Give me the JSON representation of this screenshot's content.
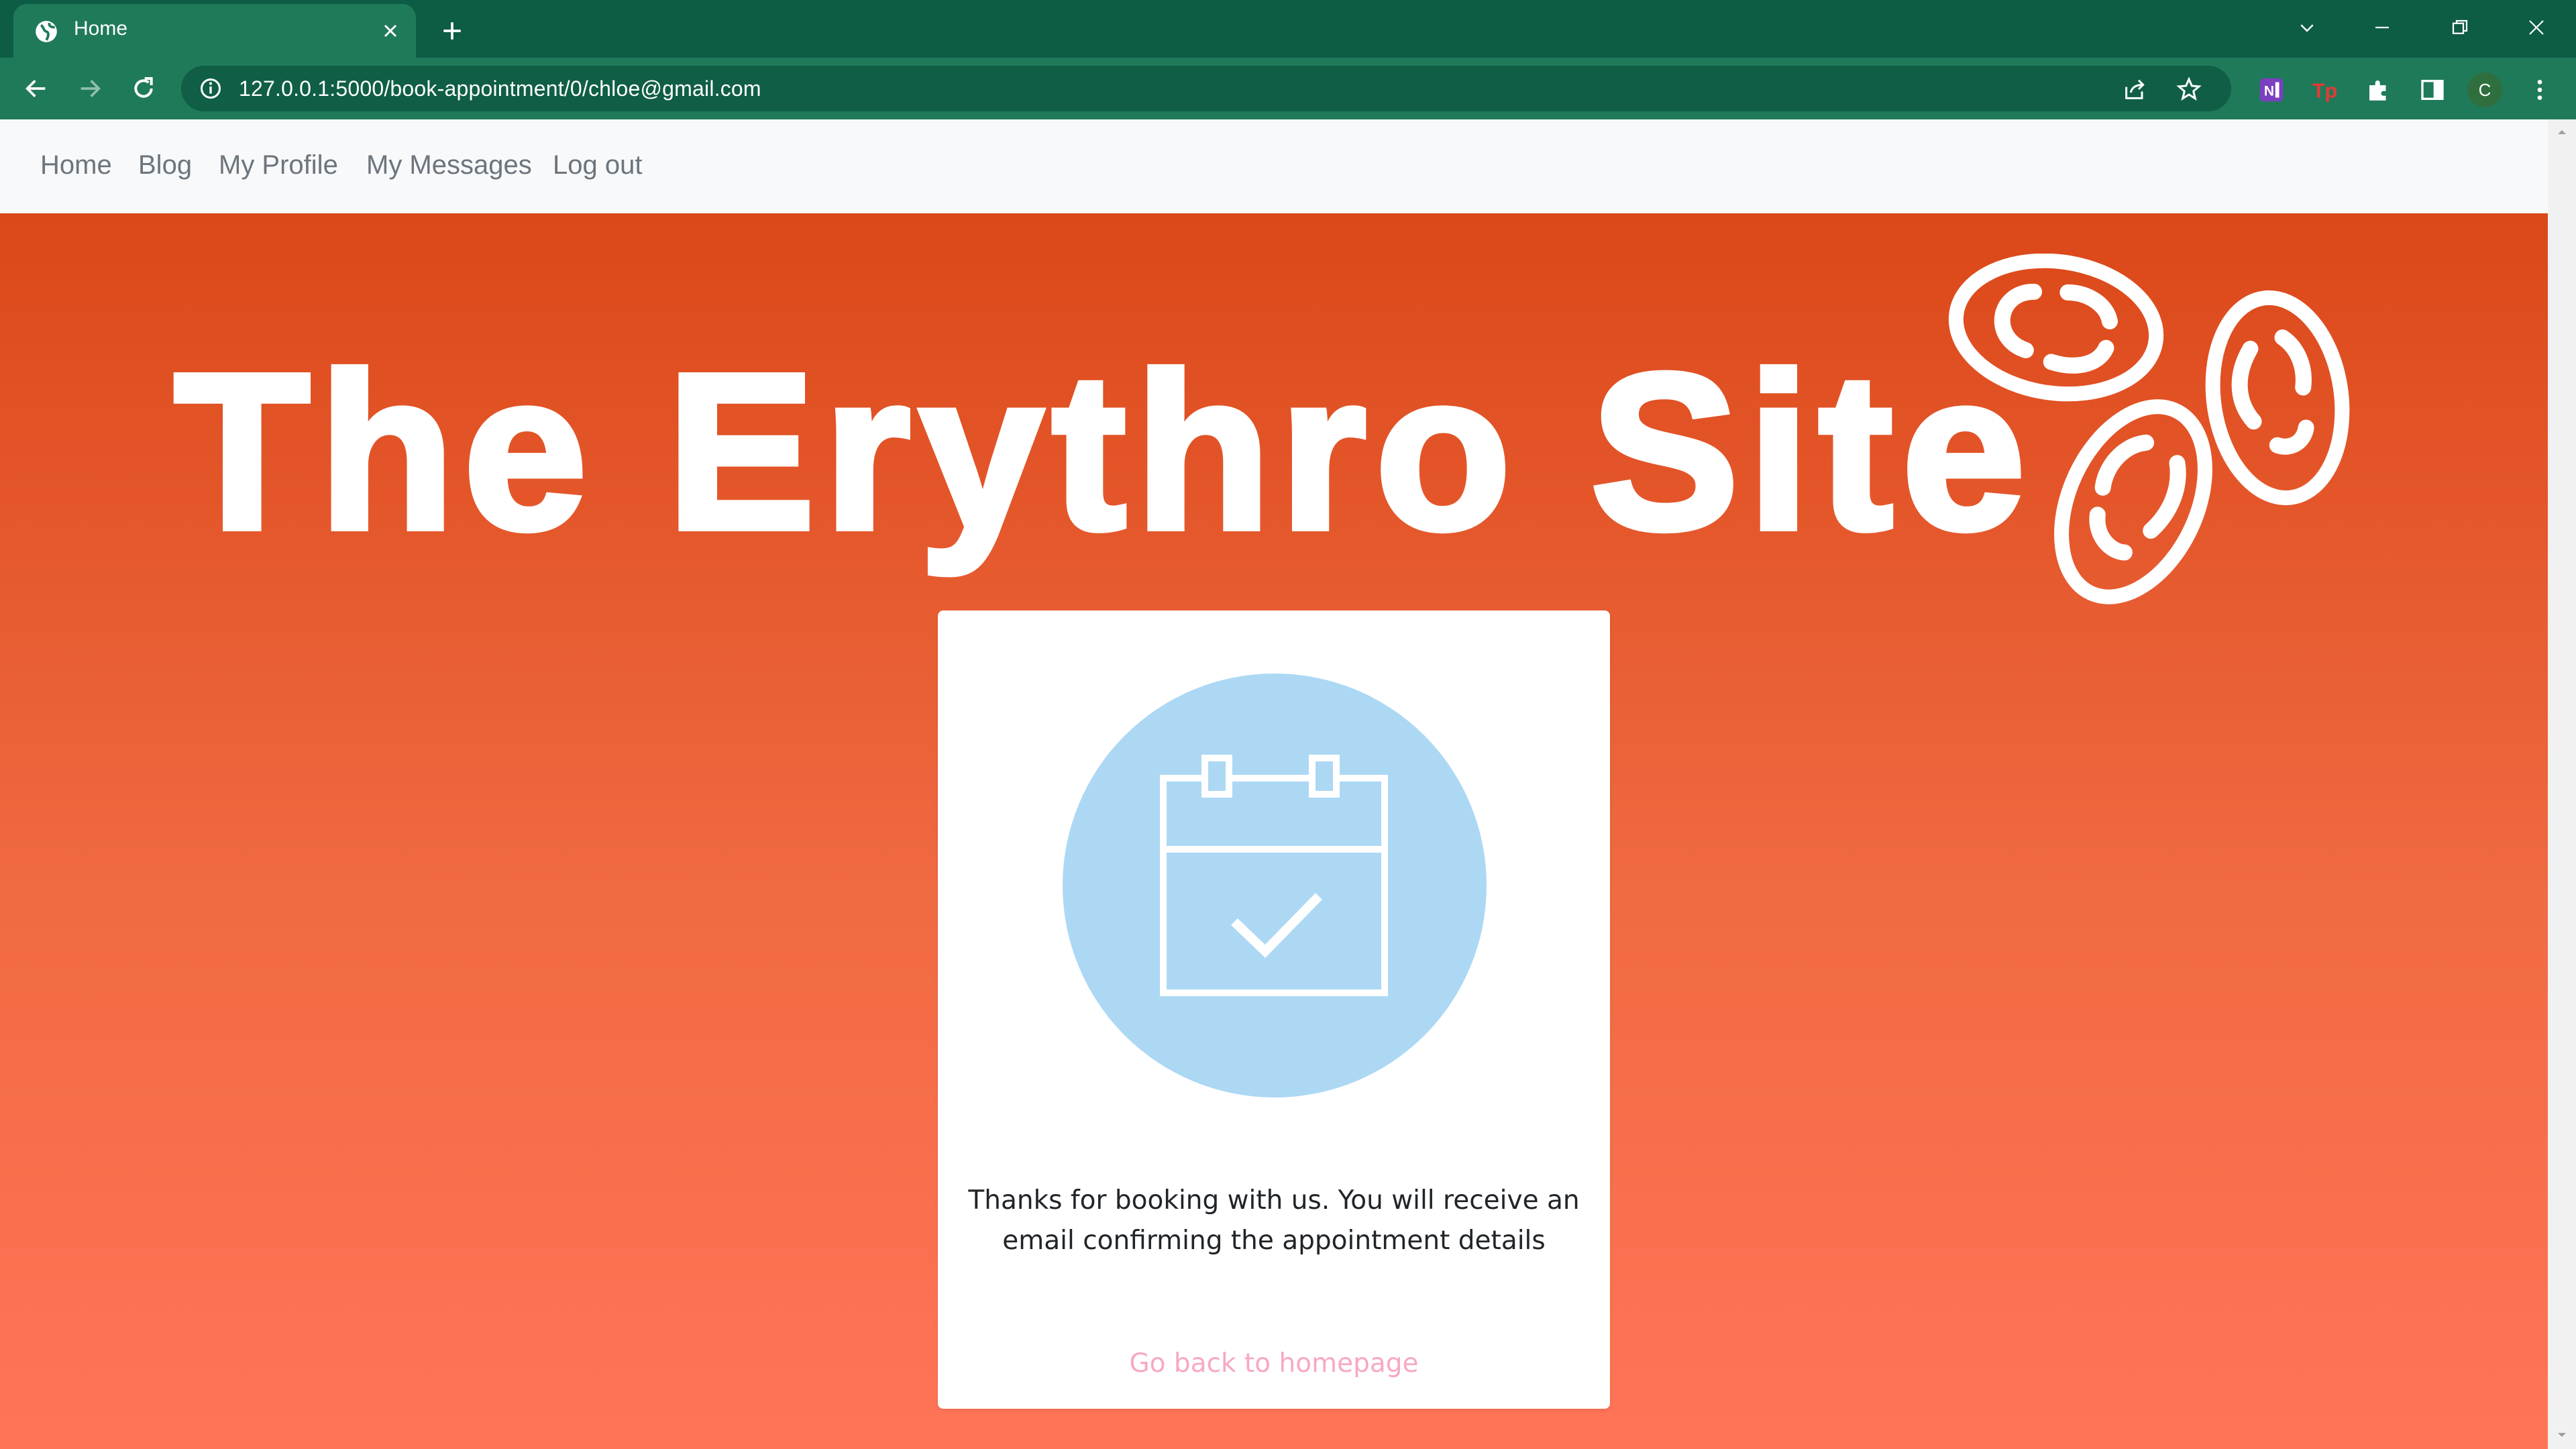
{
  "browser": {
    "tab_title": "Home",
    "url": "127.0.0.1:5000/book-appointment/0/chloe@gmail.com",
    "profile_initial": "C",
    "extensions": [
      "onenote-icon",
      "tp-extension-icon",
      "puzzle-icon",
      "side-panel-icon"
    ]
  },
  "nav": {
    "home": "Home",
    "blog": "Blog",
    "profile": "My Profile",
    "messages": "My Messages",
    "logout": "Log out"
  },
  "hero": {
    "title": "The Erythro Site"
  },
  "confirmation": {
    "message": "Thanks for booking with us. You will receive an email confirming the appointment details",
    "link": "Go back to homepage"
  },
  "colors": {
    "tab_bar": "#0d5c45",
    "toolbar": "#1f7a5a",
    "hero_top": "#db4819",
    "hero_bottom": "#ff7457",
    "calendar_circle": "#acd8f4",
    "link": "#f7a8c4"
  }
}
